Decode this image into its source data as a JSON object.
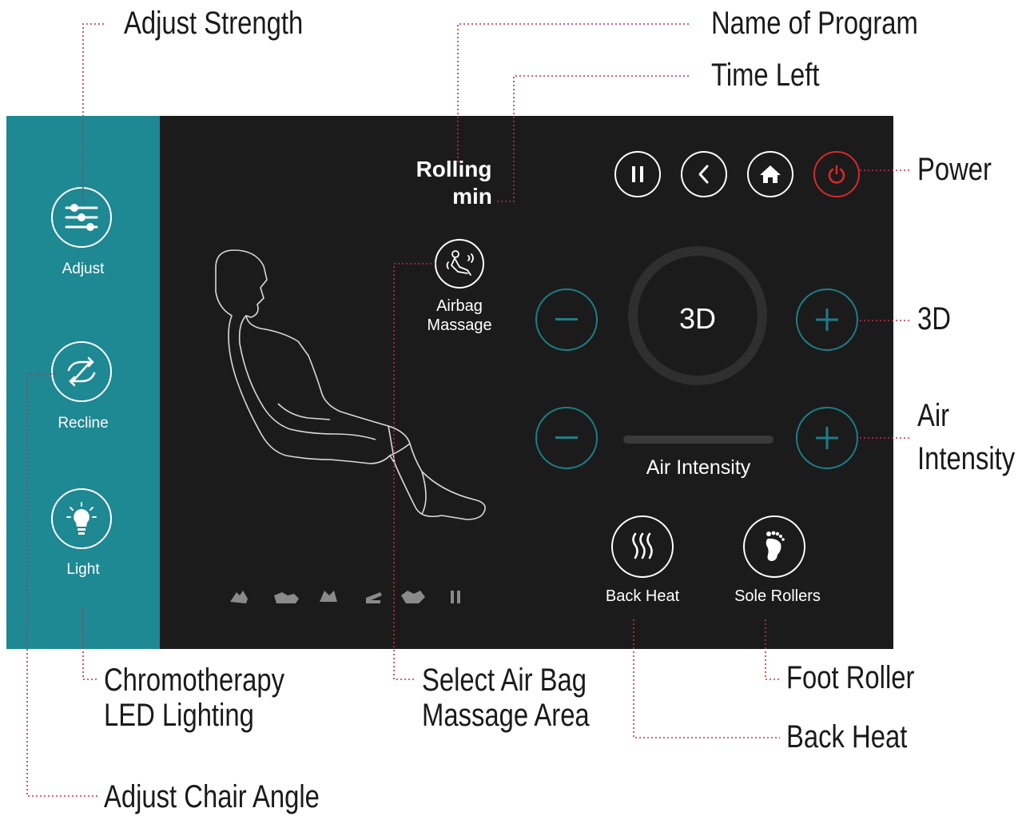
{
  "callouts": {
    "adjust_strength": "Adjust Strength",
    "name_of_program": "Name of Program",
    "time_left": "Time Left",
    "power": "Power",
    "three_d": "3D",
    "air_intensity_line1": "Air",
    "air_intensity_line2": "Intensity",
    "chromotherapy_line1": "Chromotherapy",
    "chromotherapy_line2": "LED Lighting",
    "select_air_bag_line1": "Select Air Bag",
    "select_air_bag_line2": "Massage Area",
    "foot_roller": "Foot Roller",
    "back_heat": "Back Heat",
    "adjust_chair_angle": "Adjust Chair Angle"
  },
  "sidebar": {
    "adjust_label": "Adjust",
    "recline_label": "Recline",
    "light_label": "Light"
  },
  "program": {
    "name": "Rolling",
    "time": "min"
  },
  "airbag": {
    "line1": "Airbag",
    "line2": "Massage"
  },
  "strength": {
    "value": "3D"
  },
  "air_intensity": {
    "label": "Air Intensity"
  },
  "buttons": {
    "back_heat": "Back Heat",
    "sole_rollers": "Sole Rollers"
  },
  "colors": {
    "sidebar": "#1e8893",
    "screen": "#1b1b1b",
    "accent_teal": "#1d7e88",
    "power_red": "#d42a2a",
    "callout_line": "#c0304a"
  },
  "icons": [
    "sliders-icon",
    "recline-arrows-icon",
    "lightbulb-icon",
    "pause-icon",
    "back-chevron-icon",
    "home-icon",
    "power-icon",
    "airbag-massage-icon",
    "heat-waves-icon",
    "foot-icon"
  ]
}
